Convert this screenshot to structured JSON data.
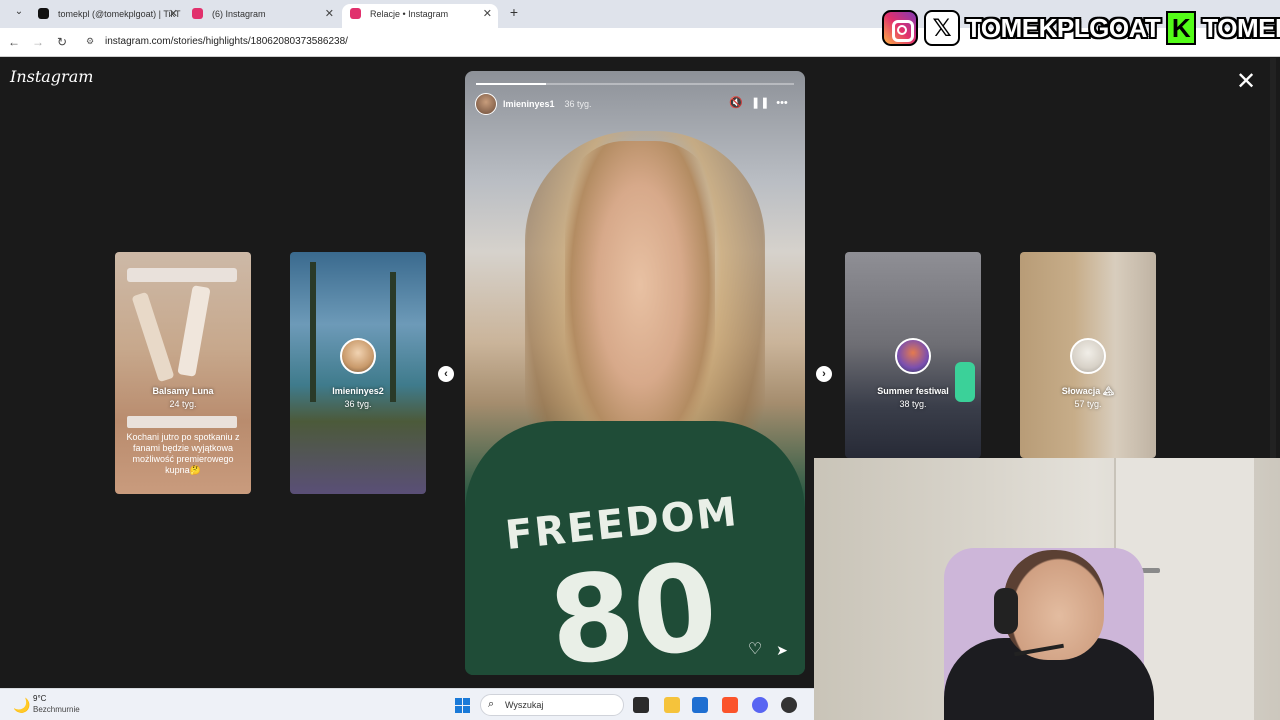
{
  "browser": {
    "tabs": [
      {
        "title": "tomekpl (@tomekplgoat) | TikT",
        "active": false,
        "favicon_color": "#111111"
      },
      {
        "title": "(6) Instagram",
        "active": false,
        "favicon_color": "#e1306c"
      },
      {
        "title": "Relacje • Instagram",
        "active": true,
        "favicon_color": "#e1306c"
      }
    ],
    "url": "instagram.com/stories/highlights/18062080373586238/"
  },
  "overlay": {
    "instagram_handle": "TOMEKPLGOAT",
    "kick_handle": "TOMEKPL",
    "x_glyph": "𝕏",
    "kick_glyph": "K"
  },
  "instagram": {
    "logo": "Instagram",
    "close_glyph": "✕",
    "main_story": {
      "username": "lmieninyes1",
      "time": "36 tyg.",
      "progress": 0.22,
      "shirt_text": "FREEDOM",
      "shirt_number": "80"
    },
    "previews": [
      {
        "name": "Balsamy Luna",
        "time": "24 tyg.",
        "caption": "Kochani jutro po spotkaniu z fanami będzie wyjątkowa możliwość premierowego kupna🤔"
      },
      {
        "name": "lmieninyes2",
        "time": "36 tyg."
      },
      {
        "name": "Summer festiwal",
        "time": "38 tyg."
      },
      {
        "name": "Słowacja 🏔",
        "time": "57 tyg."
      }
    ],
    "nav_prev_glyph": "‹",
    "nav_next_glyph": "›"
  },
  "taskbar": {
    "temperature": "9°C",
    "weather": "Bezchmurnie",
    "search_placeholder": "Wyszukaj"
  }
}
